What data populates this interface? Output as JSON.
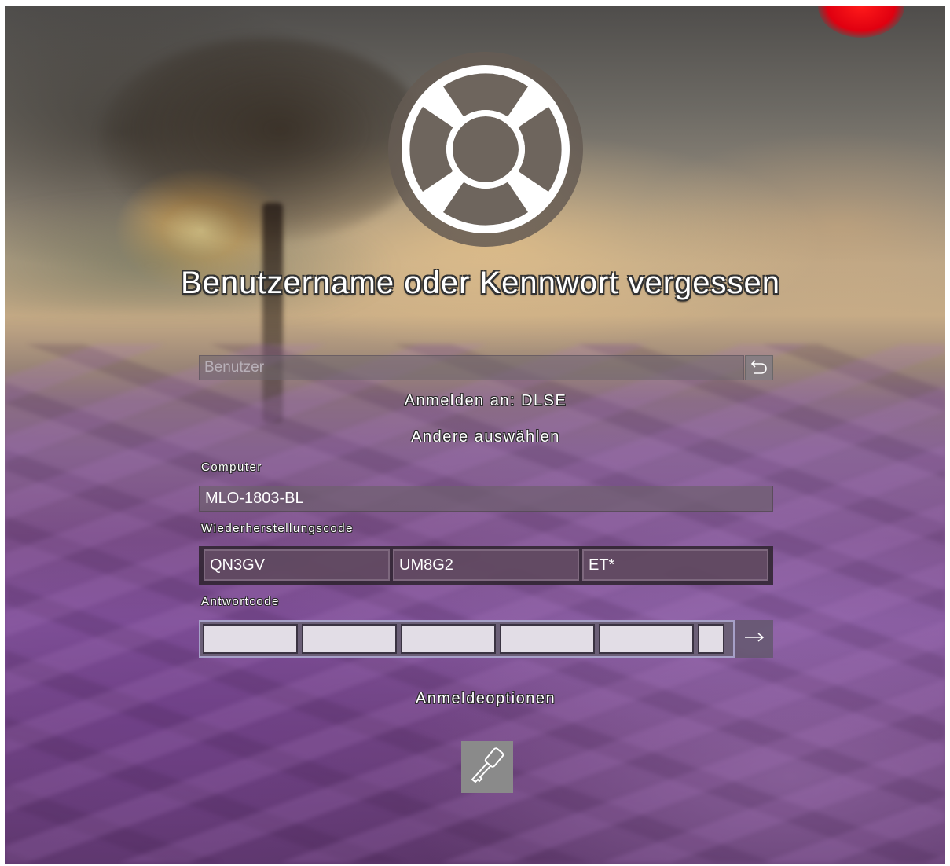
{
  "title": "Benutzername oder Kennwort vergessen",
  "user": {
    "placeholder": "Benutzer",
    "back_icon": "back-arrow-icon"
  },
  "sign_in_to": "Anmelden an: DLSE",
  "choose_other": "Andere auswählen",
  "computer": {
    "label": "Computer",
    "value": "MLO-1803-BL"
  },
  "recovery": {
    "label": "Wiederherstellungscode",
    "segments": [
      "QN3GV",
      "UM8G2",
      "ET*"
    ]
  },
  "answer": {
    "label": "Antwortcode",
    "segments": [
      "",
      "",
      "",
      "",
      "",
      ""
    ],
    "submit_icon": "right-arrow-icon"
  },
  "sign_in_options": "Anmeldeoptionen",
  "options_icon": "key-icon",
  "logo_icon": "lifebuoy-icon",
  "colors": {
    "accent_red": "#e00010",
    "answer_border": "#a6a0c8"
  }
}
